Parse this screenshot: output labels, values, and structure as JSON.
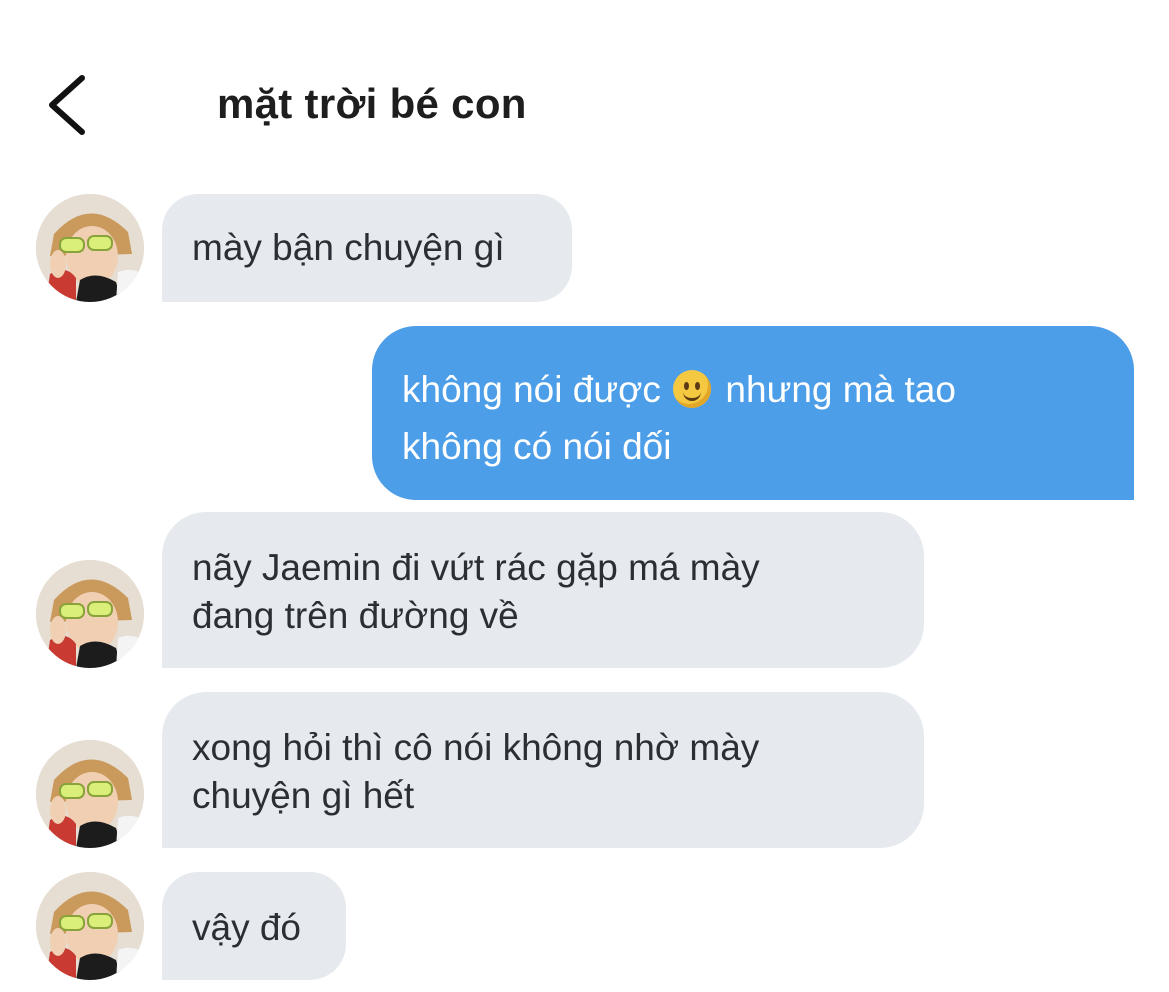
{
  "header": {
    "back_icon": "chevron-left-icon",
    "title": "mặt trời bé con"
  },
  "messages": [
    {
      "direction": "incoming",
      "lines": [
        "mày bận chuyện gì"
      ]
    },
    {
      "direction": "outgoing",
      "line1_part1": "không nói được",
      "emoji": "slightly-smiling-face",
      "line1_part2": "nhưng mà tao",
      "line2": "không có nói dối"
    },
    {
      "direction": "incoming",
      "lines": [
        "nãy Jaemin đi vứt rác gặp má mày",
        "đang trên đường về"
      ]
    },
    {
      "direction": "incoming",
      "lines": [
        "xong hỏi thì cô nói không nhờ mày",
        "chuyện gì hết"
      ]
    },
    {
      "direction": "incoming",
      "lines": [
        "vậy đó"
      ]
    }
  ],
  "colors": {
    "incoming_bubble": "#e6eaef",
    "outgoing_bubble": "#4d9ee9",
    "title_text": "#1e1e1e"
  }
}
